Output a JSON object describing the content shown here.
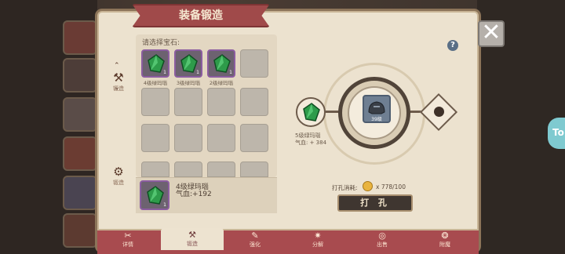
{
  "dialog": {
    "title": "装备锻造",
    "close_label": "✕",
    "help_label": "?"
  },
  "side_nav": {
    "items": [
      {
        "label": "锻造",
        "icon": "anvil-icon"
      },
      {
        "label": "锻造",
        "icon": "forge-hammer-icon"
      }
    ]
  },
  "gem_panel": {
    "prompt": "请选择宝石:",
    "gems": [
      {
        "name": "4级绿玛瑙",
        "qty": "1",
        "color": "#2e9b4a"
      },
      {
        "name": "3级绿玛瑙",
        "qty": "1",
        "color": "#2e9b4a"
      },
      {
        "name": "2级绿玛瑙",
        "qty": "1",
        "color": "#2e9b4a"
      }
    ],
    "selected": {
      "name": "4级绿玛瑙",
      "stat": "气血:+192",
      "qty": "1"
    }
  },
  "forge": {
    "hole_gem_name": "5级绿玛瑙",
    "hole_gem_stat": "气血: + 384",
    "equip_level": "39级",
    "cost_label": "打孔消耗:",
    "cost_value": "x 778/100",
    "punch_button": "打 孔"
  },
  "tabs": [
    {
      "label": "详情",
      "icon": "details-icon"
    },
    {
      "label": "锻造",
      "icon": "forge-icon"
    },
    {
      "label": "强化",
      "icon": "enhance-icon"
    },
    {
      "label": "分解",
      "icon": "decompose-icon"
    },
    {
      "label": "出售",
      "icon": "sell-icon"
    },
    {
      "label": "附魔",
      "icon": "enchant-icon"
    }
  ],
  "background": {
    "tab_tail_label": "To"
  }
}
